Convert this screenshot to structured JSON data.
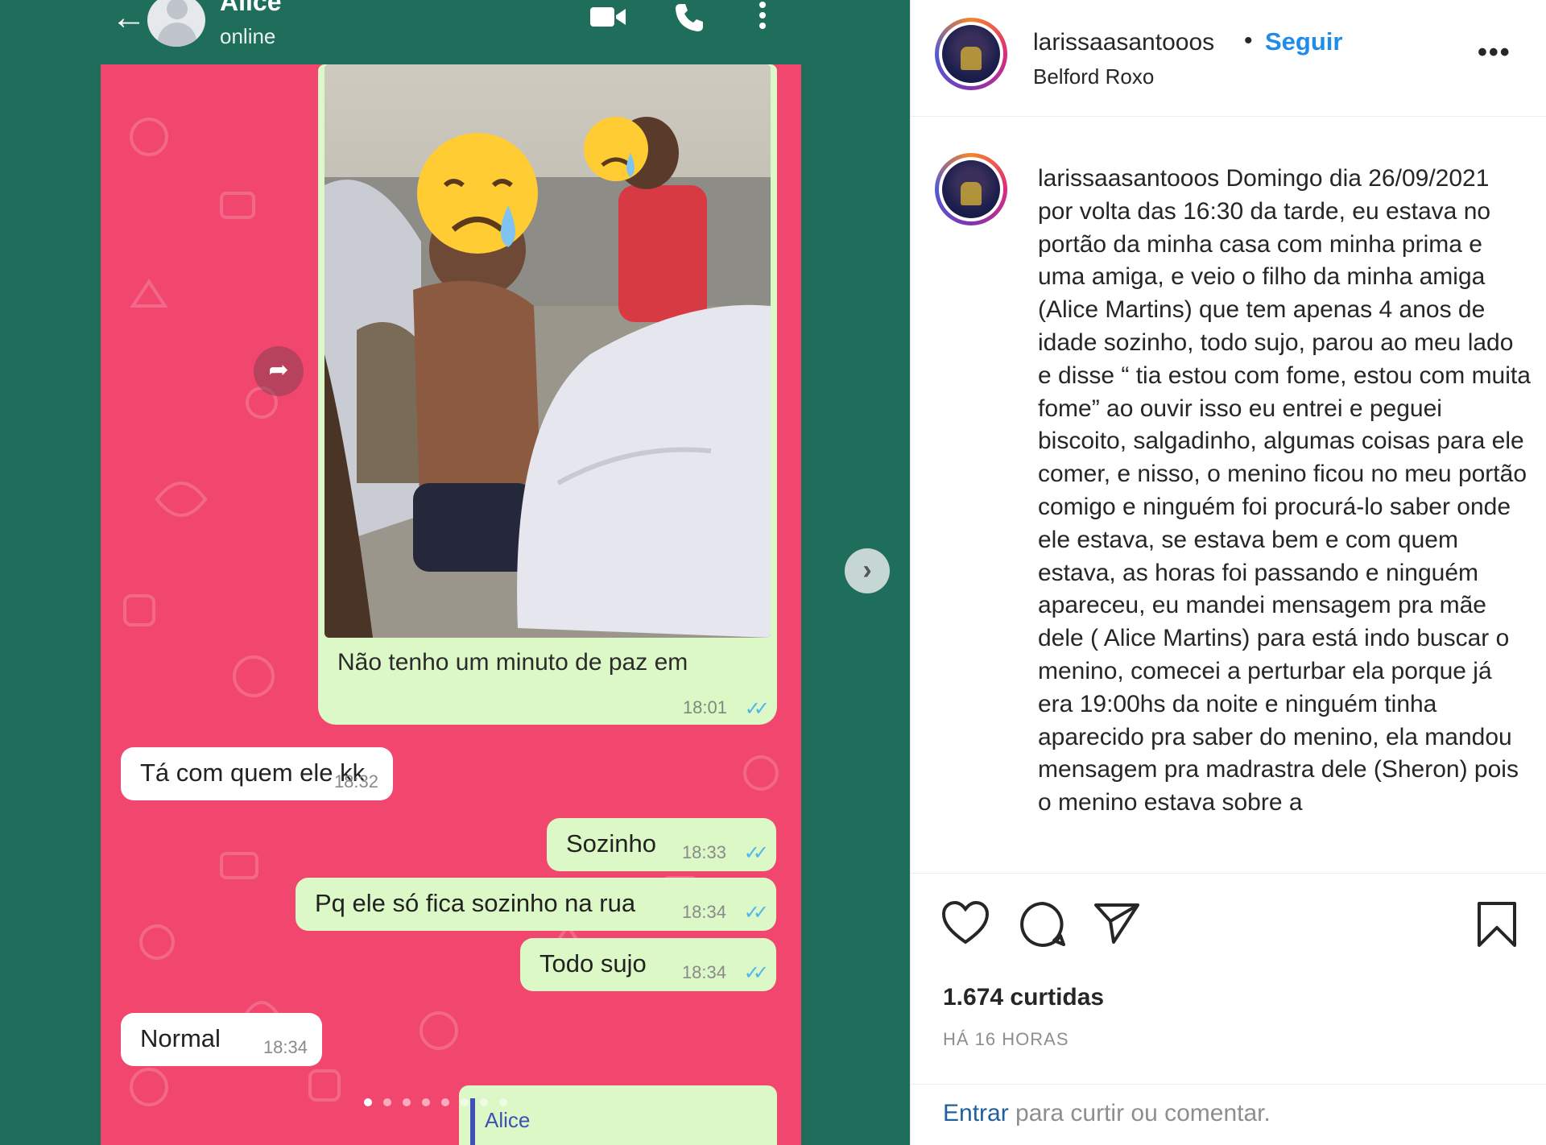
{
  "whatsapp": {
    "contact_name": "Alice",
    "contact_status": "online",
    "photo_caption": "Não tenho um minuto de paz em",
    "photo_time": "18:01",
    "messages": [
      {
        "direction": "in",
        "text": "Tá com quem ele kk",
        "time": "18:32"
      },
      {
        "direction": "out",
        "text": "Sozinho",
        "time": "18:33"
      },
      {
        "direction": "out",
        "text": "Pq ele só fica sozinho na rua",
        "time": "18:34"
      },
      {
        "direction": "out",
        "text": "Todo sujo",
        "time": "18:34"
      },
      {
        "direction": "in",
        "text": "Normal",
        "time": "18:34"
      }
    ],
    "quoted_name": "Alice",
    "ticks": "✓✓"
  },
  "carousel": {
    "slide_count": 8,
    "active_index": 0
  },
  "instagram": {
    "username": "larissaasantooos",
    "separator": "•",
    "follow_label": "Seguir",
    "location": "Belford Roxo",
    "more_label": "•••",
    "caption": "Domingo dia 26/09/2021 por volta das 16:30 da tarde, eu estava no portão da minha casa com minha prima e uma amiga, e veio o filho da minha amiga (Alice Martins) que tem apenas 4 anos de idade sozinho, todo sujo, parou ao meu lado e disse “ tia estou com fome, estou com muita fome” ao ouvir isso eu entrei e peguei biscoito, salgadinho, algumas coisas para ele comer, e nisso, o menino ficou no meu portão comigo e ninguém foi procurá-lo saber onde ele estava, se estava bem e com quem estava, as horas foi passando e ninguém apareceu, eu mandei mensagem pra mãe dele ( Alice Martins) para está indo buscar o menino, comecei a perturbar ela porque já era 19:00hs da noite e ninguém tinha aparecido pra saber do menino, ela mandou mensagem pra madrastra dele (Sheron) pois o menino estava sobre a",
    "likes": "1.674 curtidas",
    "posted_ago": "HÁ 16 HORAS",
    "login_link": "Entrar",
    "login_suffix": " para curtir ou comentar."
  },
  "colors": {
    "wa_teal": "#1f6e5c",
    "chat_pink": "#f1476f",
    "out_bubble": "#dcf8c6",
    "ig_blue": "#1f8cea"
  }
}
